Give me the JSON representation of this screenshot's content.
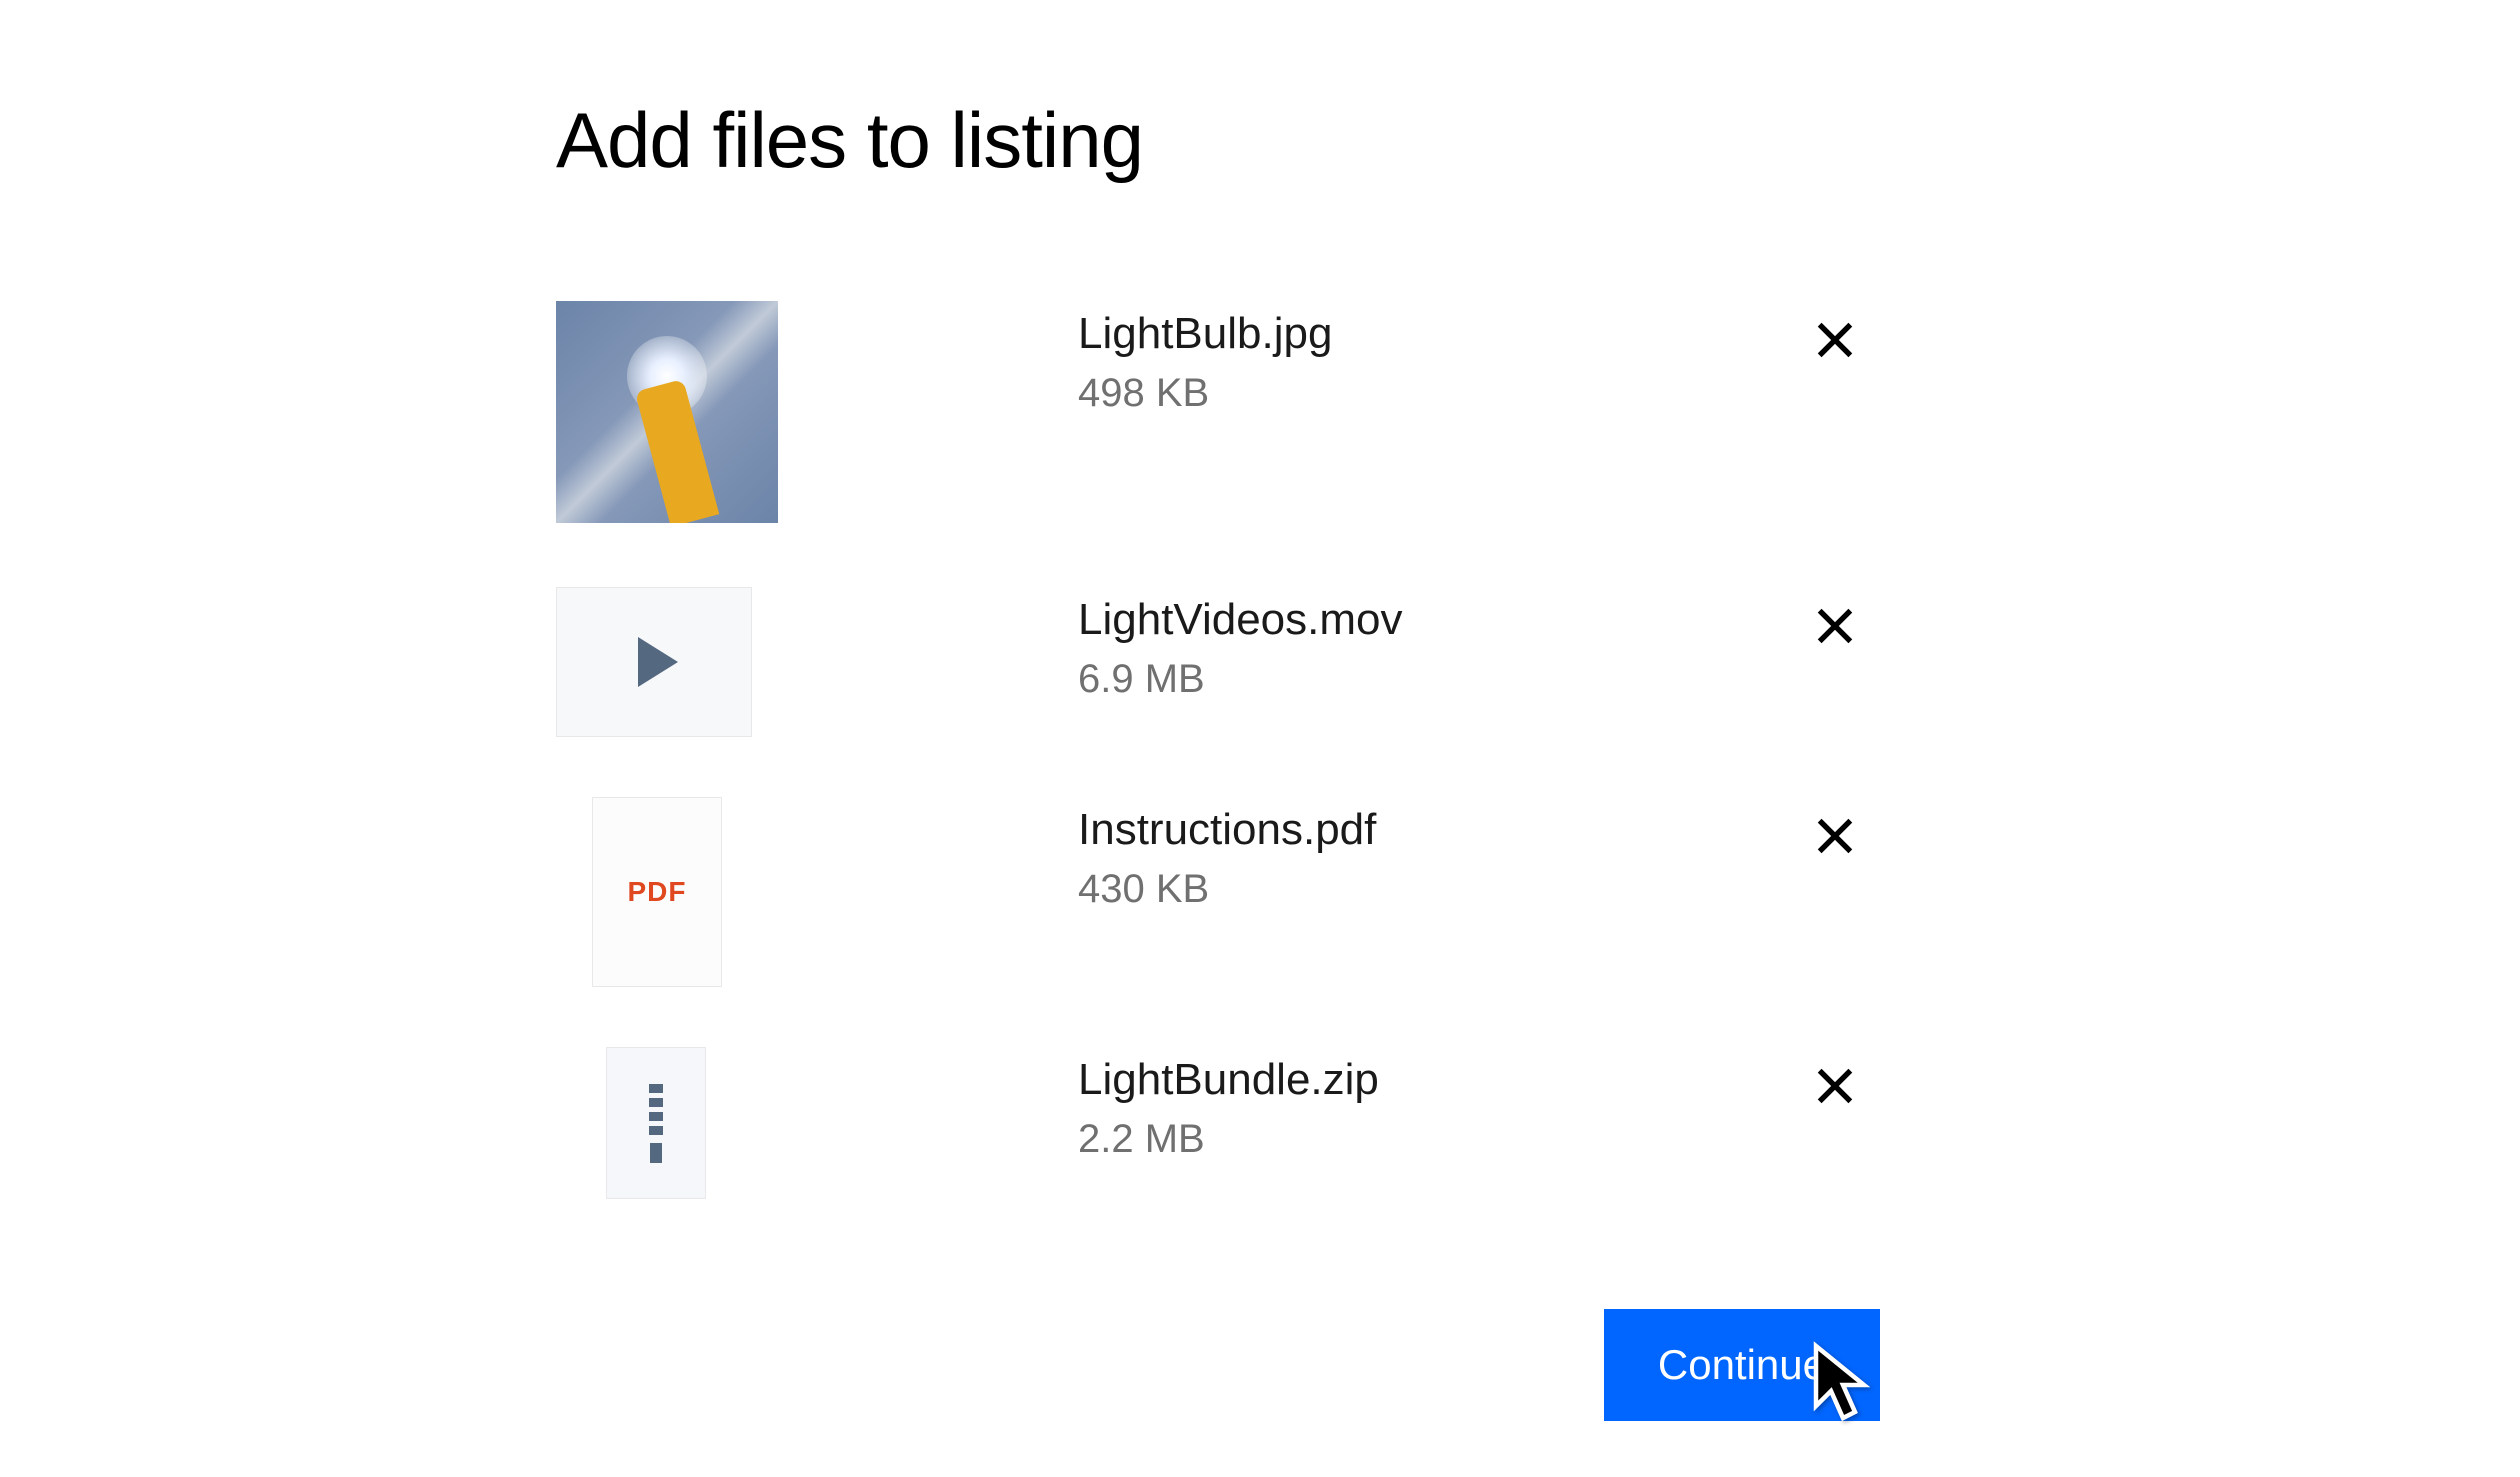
{
  "title": "Add files to listing",
  "files": [
    {
      "name": "LightBulb.jpg",
      "size": "498 KB",
      "type": "image"
    },
    {
      "name": "LightVideos.mov",
      "size": "6.9 MB",
      "type": "video"
    },
    {
      "name": "Instructions.pdf",
      "size": "430 KB",
      "type": "pdf"
    },
    {
      "name": "LightBundle.zip",
      "size": "2.2 MB",
      "type": "zip"
    }
  ],
  "pdf_label": "PDF",
  "continue_label": "Continue"
}
